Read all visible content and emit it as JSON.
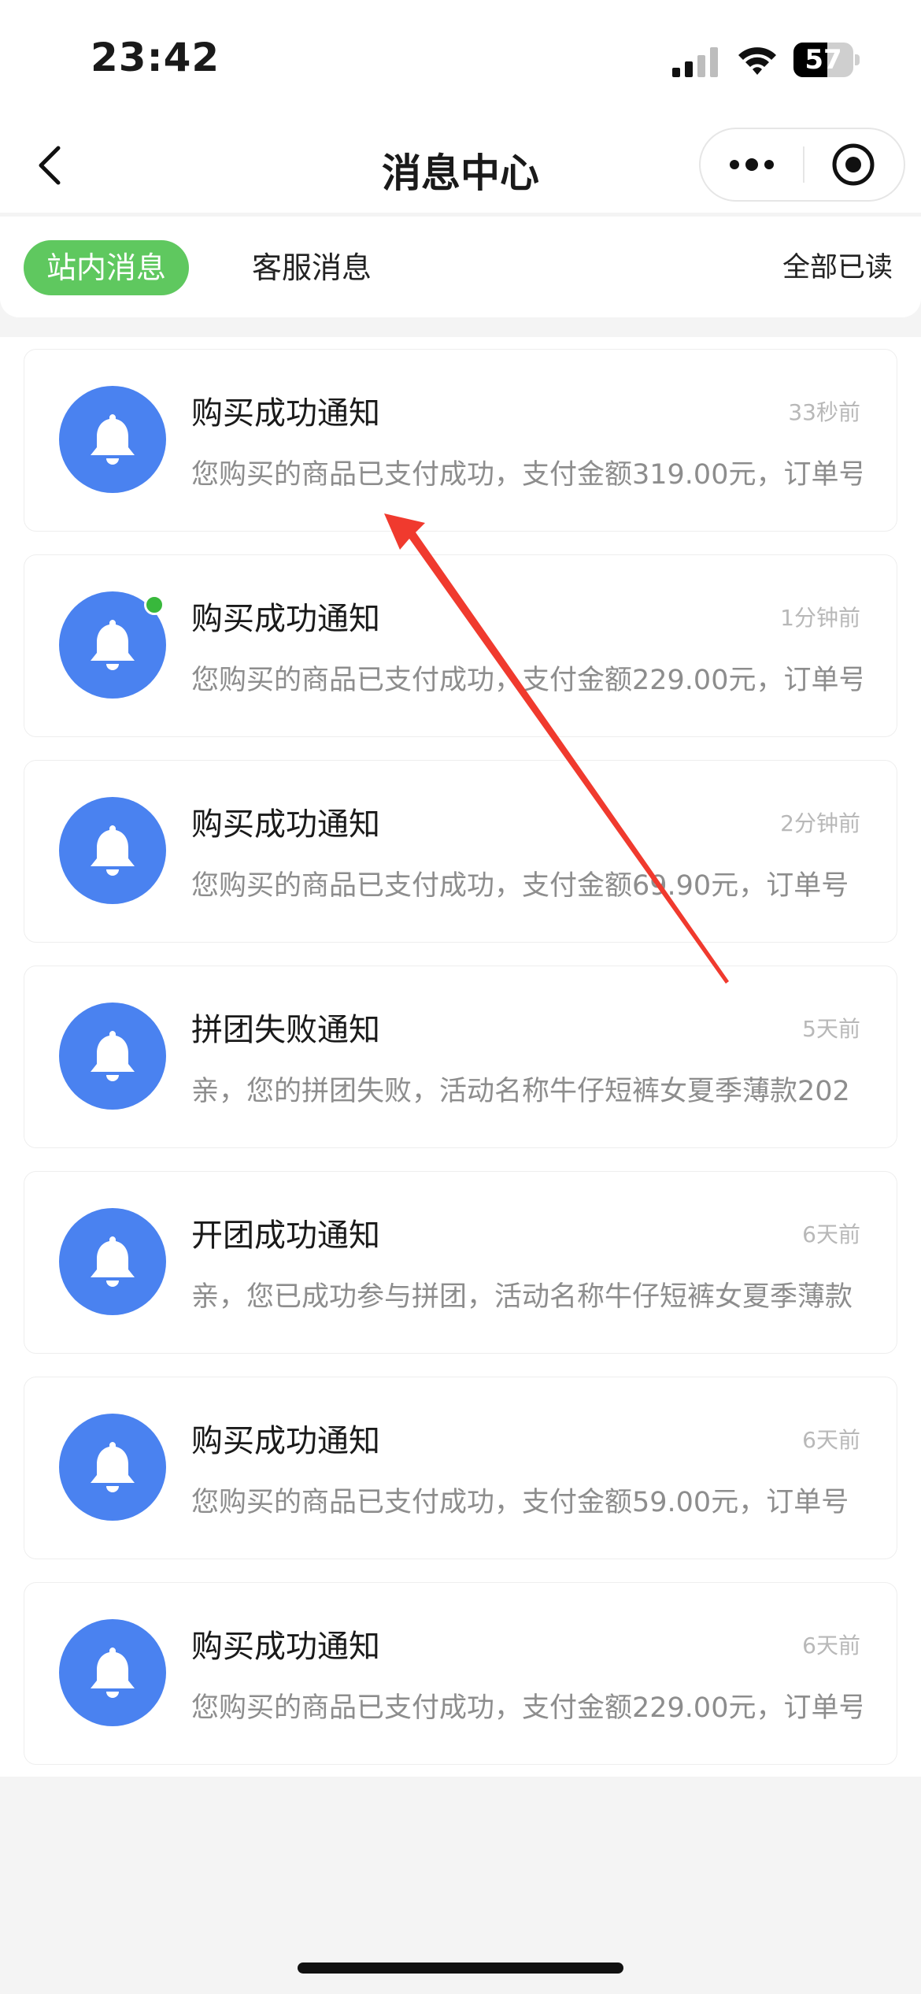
{
  "status_bar": {
    "time": "23:42",
    "battery_level": "57",
    "battery_fraction": 0.57,
    "signal_icon": "cellular-signal-icon",
    "wifi_icon": "wifi-icon"
  },
  "nav": {
    "title": "消息中心",
    "back_icon": "chevron-left-icon",
    "more_icon": "more-dots-icon",
    "close_icon": "target-close-icon"
  },
  "tabs": {
    "items": [
      {
        "label": "站内消息",
        "active": true
      },
      {
        "label": "客服消息",
        "active": false
      }
    ],
    "mark_all_read": "全部已读"
  },
  "colors": {
    "accent_green": "#5fc85f",
    "avatar_blue": "#4a82f0",
    "unread_dot": "#38b83c",
    "annotation_arrow": "#f03a2e"
  },
  "messages": [
    {
      "title": "购买成功通知",
      "time": "33秒前",
      "desc": "您购买的商品已支付成功，支付金额319.00元，订单号",
      "unread": false,
      "icon": "bell-icon"
    },
    {
      "title": "购买成功通知",
      "time": "1分钟前",
      "desc": "您购买的商品已支付成功，支付金额229.00元，订单号",
      "unread": true,
      "icon": "bell-icon"
    },
    {
      "title": "购买成功通知",
      "time": "2分钟前",
      "desc": "您购买的商品已支付成功，支付金额69.90元，订单号",
      "unread": false,
      "icon": "bell-icon"
    },
    {
      "title": "拼团失败通知",
      "time": "5天前",
      "desc": "亲，您的拼团失败，活动名称牛仔短裤女夏季薄款202",
      "unread": false,
      "icon": "bell-icon"
    },
    {
      "title": "开团成功通知",
      "time": "6天前",
      "desc": "亲，您已成功参与拼团，活动名称牛仔短裤女夏季薄款",
      "unread": false,
      "icon": "bell-icon"
    },
    {
      "title": "购买成功通知",
      "time": "6天前",
      "desc": "您购买的商品已支付成功，支付金额59.00元，订单号",
      "unread": false,
      "icon": "bell-icon"
    },
    {
      "title": "购买成功通知",
      "time": "6天前",
      "desc": "您购买的商品已支付成功，支付金额229.00元，订单号",
      "unread": false,
      "icon": "bell-icon"
    }
  ]
}
